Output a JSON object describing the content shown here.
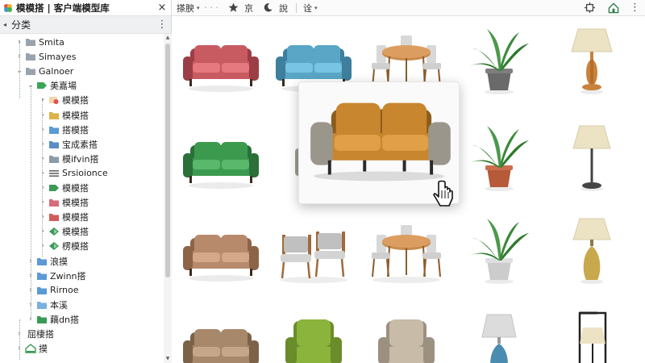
{
  "window": {
    "title": "模模搭 | 客户端模型库",
    "close_glyph": "×"
  },
  "panel": {
    "header_label": "分类",
    "collapse_glyph": "◂",
    "more_glyph": "⋮"
  },
  "tree": [
    {
      "label": "Smita",
      "level": 0,
      "toggle": "›",
      "icon": "folder-gray-icon",
      "color": "#9aa3ad"
    },
    {
      "label": "Simayes",
      "level": 0,
      "toggle": "›",
      "icon": "folder-gray-icon",
      "color": "#9aa3ad"
    },
    {
      "label": "Galnoer",
      "level": 0,
      "toggle": "⌄",
      "icon": "folder-gray-icon",
      "color": "#9aa3ad"
    },
    {
      "label": "美嘉場",
      "level": 1,
      "toggle": "⌄",
      "icon": "tag-green-icon",
      "color": "#3aa655"
    },
    {
      "label": "模模搭",
      "level": 2,
      "toggle": "›",
      "icon": "image-red-icon",
      "color": "#e05050"
    },
    {
      "label": "模模搭",
      "level": 2,
      "toggle": "›",
      "icon": "folder-yellow-icon",
      "color": "#d9b44a"
    },
    {
      "label": "搭模搭",
      "level": 2,
      "toggle": "›",
      "icon": "folder-blue-icon",
      "color": "#5a9ad6"
    },
    {
      "label": "宝成素搭",
      "level": 2,
      "toggle": "›",
      "icon": "folder-blue-icon",
      "color": "#5a8cc6"
    },
    {
      "label": "模ifvin搭",
      "level": 2,
      "toggle": "›",
      "icon": "folder-gray-icon",
      "color": "#8e9aa6"
    },
    {
      "label": "Srsioionce",
      "level": 2,
      "toggle": "›",
      "icon": "list-icon",
      "color": "#666666"
    },
    {
      "label": "模模搭",
      "level": 2,
      "toggle": "›",
      "icon": "tag-green-icon",
      "color": "#3a9a55"
    },
    {
      "label": "模模搭",
      "level": 2,
      "toggle": "›",
      "icon": "folder-pink-icon",
      "color": "#d86a7a"
    },
    {
      "label": "模模搭",
      "level": 2,
      "toggle": "›",
      "icon": "folder-red-icon",
      "color": "#d25a5a"
    },
    {
      "label": "模模搭",
      "level": 2,
      "toggle": "›",
      "icon": "diamond-green-icon",
      "color": "#3a9a55"
    },
    {
      "label": "楞模搭",
      "level": 2,
      "toggle": "›",
      "icon": "diamond-green-icon",
      "color": "#3a9a55"
    },
    {
      "label": "浪摸",
      "level": 1,
      "toggle": "›",
      "icon": "folder-blue-icon",
      "color": "#5a9ad6"
    },
    {
      "label": "Zwinn搭",
      "level": 1,
      "toggle": "›",
      "icon": "folder-blue-icon",
      "color": "#5a9ad6"
    },
    {
      "label": "Rirnoe",
      "level": 1,
      "toggle": "›",
      "icon": "folder-blue-icon",
      "color": "#5a9ad6"
    },
    {
      "label": "本溪",
      "level": 1,
      "toggle": "›",
      "icon": "folder-blue-icon",
      "color": "#7ab0de"
    },
    {
      "label": "藕dn搭",
      "level": 1,
      "toggle": "›",
      "icon": "folder-green-icon",
      "color": "#3a9a55"
    },
    {
      "label": "屈棲搭",
      "level": 0,
      "toggle": "›",
      "icon": "none",
      "color": "#000000"
    },
    {
      "label": "摸",
      "level": 0,
      "toggle": "›",
      "icon": "house-icon",
      "color": "#3a9a55"
    }
  ],
  "toolbar": {
    "view_label": "搽腴",
    "view_dots": "· · ·",
    "star_icon": "star-icon",
    "sort_label": "京",
    "moon_icon": "moon-icon",
    "settings_label": "說",
    "filter_label": "诠",
    "dropdown_glyph": "▾",
    "pin_icon": "pin-icon",
    "home_icon": "home-icon",
    "more_glyph": "⋮"
  },
  "grid": [
    {
      "model": "sofa",
      "color": "#c85a62",
      "dark": "#9c3e46"
    },
    {
      "model": "sofa",
      "color": "#5aa6c6",
      "dark": "#3d7f9c"
    },
    {
      "model": "dining-set",
      "color": "#c88a4c",
      "dark": "#8c5c2c"
    },
    {
      "model": "plant",
      "color": "#3c8a3c",
      "dark": "#6a6a6a"
    },
    {
      "model": "lamp-round",
      "color": "#ece2c4",
      "dark": "#c8823c"
    },
    {
      "model": "sofa",
      "color": "#3c9a4e",
      "dark": "#2a7038"
    },
    {
      "model": "sofa-hidden",
      "color": "#c88a3c",
      "dark": "#94602a"
    },
    {
      "model": "hidden",
      "color": "#ffffff",
      "dark": "#ffffff"
    },
    {
      "model": "plant",
      "color": "#3c8a3c",
      "dark": "#b65a3a"
    },
    {
      "model": "lamp-floor",
      "color": "#ece2c4",
      "dark": "#444444"
    },
    {
      "model": "sofa",
      "color": "#b88a6c",
      "dark": "#8c6448"
    },
    {
      "model": "chairs-pair",
      "color": "#c0c0c0",
      "dark": "#a06a3c"
    },
    {
      "model": "dining-set",
      "color": "#c88a4c",
      "dark": "#8c5c2c"
    },
    {
      "model": "plant",
      "color": "#3c8a3c",
      "dark": "#cccccc"
    },
    {
      "model": "lamp-vase",
      "color": "#ece2c4",
      "dark": "#c8a84c"
    },
    {
      "model": "sofa",
      "color": "#a8886a",
      "dark": "#7c6248"
    },
    {
      "model": "armchair",
      "color": "#8ab43c",
      "dark": "#6a8c2a"
    },
    {
      "model": "armchair",
      "color": "#c8bca8",
      "dark": "#9c9080"
    },
    {
      "model": "lamp-blue",
      "color": "#dcdcdc",
      "dark": "#4a8cb0"
    },
    {
      "model": "lamp-cage",
      "color": "#ece2c4",
      "dark": "#222222"
    }
  ],
  "hover_card": {
    "model": "sofa-large",
    "color": "#c8862e",
    "dark": "#8c5c1c"
  }
}
